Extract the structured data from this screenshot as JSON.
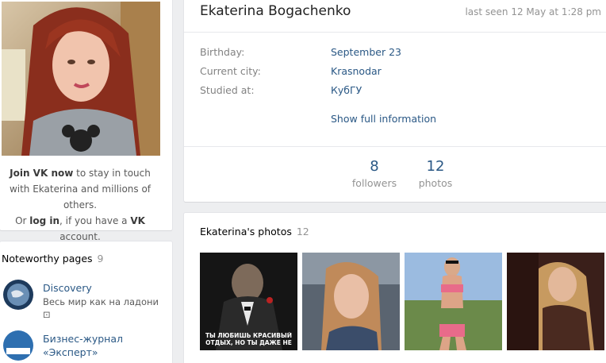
{
  "left": {
    "join_bold": "Join VK now",
    "join_rest": " to stay in touch with Ekaterina and millions of others.",
    "or_text": "Or ",
    "login": "log in",
    "if_text": ", if you have a ",
    "vk": "VK",
    "account": " account."
  },
  "noteworthy": {
    "title": "Noteworthy pages",
    "count": "9",
    "items": [
      {
        "name": "Discovery",
        "desc": "Весь мир как на ладони"
      },
      {
        "name": "Бизнес-журнал «Эксперт»",
        "desc": ""
      }
    ]
  },
  "profile": {
    "name": "Ekaterina Bogachenko",
    "last_seen": "last seen 12 May at 1:28 pm",
    "rows": [
      {
        "label": "Birthday:",
        "value": "September 23"
      },
      {
        "label": "Current city:",
        "value": "Krasnodar"
      },
      {
        "label": "Studied at:",
        "value": "КубГУ"
      }
    ],
    "show_full": "Show full information",
    "counters": [
      {
        "num": "8",
        "label": "followers"
      },
      {
        "num": "12",
        "label": "photos"
      }
    ]
  },
  "photos": {
    "title": "Ekaterina's photos",
    "count": "12",
    "caption_1": "ТЫ ЛЮБИШЬ КРАСИВЫЙ ОТДЫХ, НО ТЫ ДАЖЕ НЕ"
  },
  "colors": {
    "link": "#2a5885",
    "muted": "#939393",
    "background": "#edeef0"
  }
}
